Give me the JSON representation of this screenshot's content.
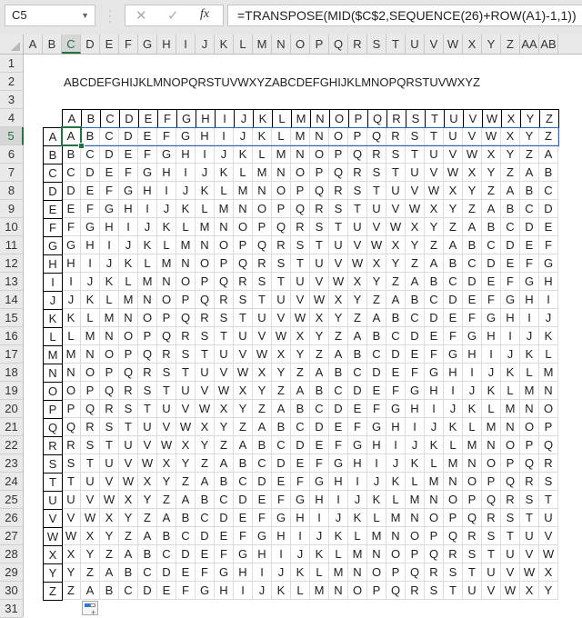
{
  "toolbar": {
    "name_box": "C5",
    "cancel_icon": "✕",
    "enter_icon": "✓",
    "fx_label": "fx",
    "formula": "=TRANSPOSE(MID($C$2,SEQUENCE(26)+ROW(A1)-1,1))"
  },
  "columns": [
    "A",
    "B",
    "C",
    "D",
    "E",
    "F",
    "G",
    "H",
    "I",
    "J",
    "K",
    "L",
    "M",
    "N",
    "O",
    "P",
    "Q",
    "R",
    "S",
    "T",
    "U",
    "V",
    "W",
    "X",
    "Y",
    "Z",
    "AA",
    "AB"
  ],
  "selected_column": "C",
  "rows": [
    1,
    2,
    3,
    4,
    5,
    6,
    7,
    8,
    9,
    10,
    11,
    12,
    13,
    14,
    15,
    16,
    17,
    18,
    19,
    20,
    21,
    22,
    23,
    24,
    25,
    26,
    27,
    28,
    29,
    30,
    31
  ],
  "selected_row": 5,
  "cell_C2": "ABCDEFGHIJKLMNOPQRSTUVWXYZABCDEFGHIJKLMNOPQRSTUVWXYZ",
  "header_row_4": [
    "A",
    "B",
    "C",
    "D",
    "E",
    "F",
    "G",
    "H",
    "I",
    "J",
    "K",
    "L",
    "M",
    "N",
    "O",
    "P",
    "Q",
    "R",
    "S",
    "T",
    "U",
    "V",
    "W",
    "X",
    "Y",
    "Z"
  ],
  "row_labels_B": [
    "A",
    "B",
    "C",
    "D",
    "E",
    "F",
    "G",
    "H",
    "I",
    "J",
    "K",
    "L",
    "M",
    "N",
    "O",
    "P",
    "Q",
    "R",
    "S",
    "T",
    "U",
    "V",
    "W",
    "X",
    "Y",
    "Z"
  ],
  "grid_rows": [
    "ABCDEFGHIJKLMNOPQRSTUVWXYZ",
    "BCDEFGHIJKLMNOPQRSTUVWXYZA",
    "CDEFGHIJKLMNOPQRSTUVWXYZAB",
    "DEFGHIJKLMNOPQRSTUVWXYZABC",
    "EFGHIJKLMNOPQRSTUVWXYZABCD",
    "FGHIJKLMNOPQRSTUVWXYZABCDE",
    "GHIJKLMNOPQRSTUVWXYZABCDEF",
    "HIJKLMNOPQRSTUVWXYZABCDEFG",
    "IJKLMNOPQRSTUVWXYZABCDEFGH",
    "JKLMNOPQRSTUVWXYZABCDEFGHI",
    "KLMNOPQRSTUVWXYZABCDEFGHIJ",
    "LMNOPQRSTUVWXYZABCDEFGHIJK",
    "MNOPQRSTUVWXYZABCDEFGHIJKL",
    "NOPQRSTUVWXYZABCDEFGHIJKLM",
    "OPQRSTUVWXYZABCDEFGHIJKLMN",
    "PQRSTUVWXYZABCDEFGHIJKLMNO",
    "QRSTUVWXYZABCDEFGHIJKLMNOP",
    "RSTUVWXYZABCDEFGHIJKLMNOPQ",
    "STUVWXYZABCDEFGHIJKLMNOPQR",
    "TUVWXYZABCDEFGHIJKLMNOPQRS",
    "UVWXYZABCDEFGHIJKLMNOPQRST",
    "VWXYZABCDEFGHIJKLMNOPQRSTU",
    "WXYZABCDEFGHIJKLMNOPQRSTUV",
    "XYZABCDEFGHIJKLMNOPQRSTUVW",
    "YZABCDEFGHIJKLMNOPQRSTUVWX",
    "ZABCDEFGHIJKLMNOPQRSTUVWXY"
  ],
  "colors": {
    "selection": "#217346",
    "spill_border": "#2e62b8"
  }
}
